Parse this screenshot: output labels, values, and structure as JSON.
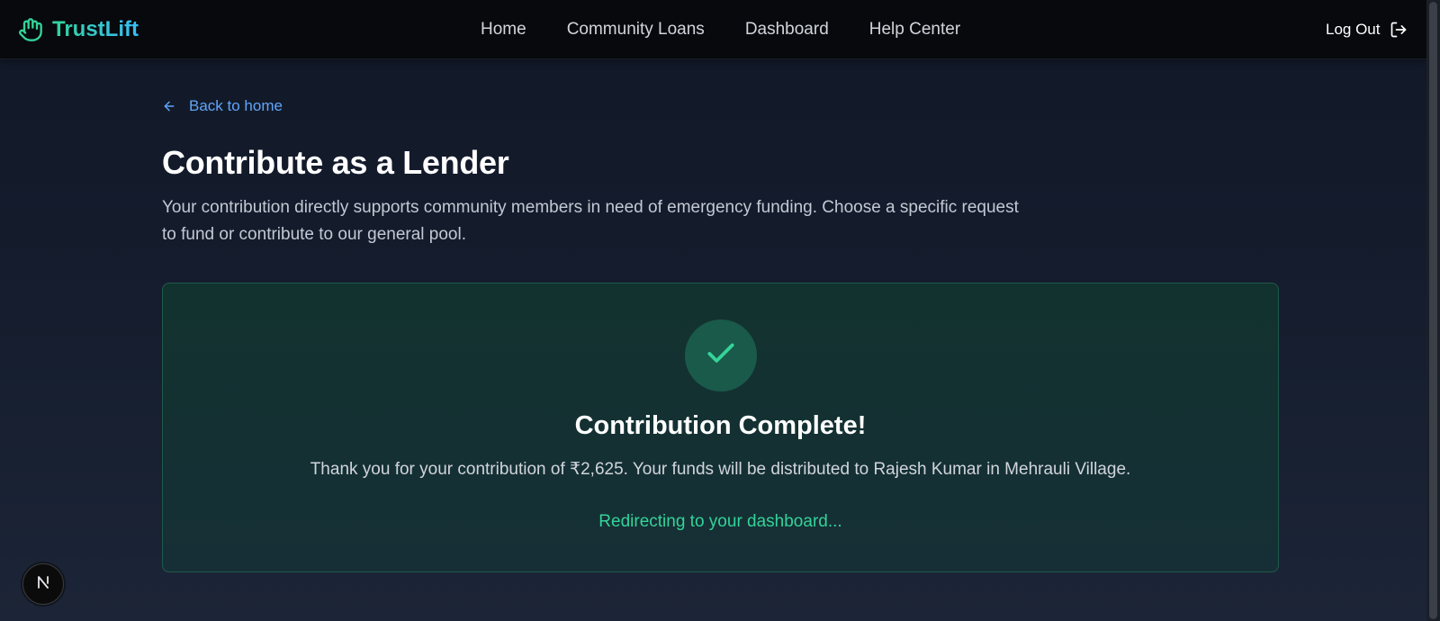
{
  "brand": {
    "name": "TrustLift",
    "icon": "hand-icon"
  },
  "nav": {
    "links": [
      {
        "label": "Home"
      },
      {
        "label": "Community Loans"
      },
      {
        "label": "Dashboard"
      },
      {
        "label": "Help Center"
      }
    ],
    "logout_label": "Log Out",
    "logout_icon": "logout-icon"
  },
  "back_link": {
    "label": "Back to home",
    "icon": "arrow-left-icon"
  },
  "page": {
    "title": "Contribute as a Lender",
    "description": "Your contribution directly supports community members in need of emergency funding. Choose a specific request to fund or contribute to our general pool."
  },
  "success": {
    "icon": "check-icon",
    "title": "Contribution Complete!",
    "message": "Thank you for your contribution of ₹2,625. Your funds will be distributed to Rajesh Kumar in Mehrauli Village.",
    "redirect": "Redirecting to your dashboard..."
  },
  "dev_badge": {
    "label": "N",
    "icon": "nextjs-icon"
  },
  "colors": {
    "accent_green": "#34d399",
    "link_blue": "#60a5fa",
    "background": "#111827",
    "navbar": "#07090d"
  }
}
